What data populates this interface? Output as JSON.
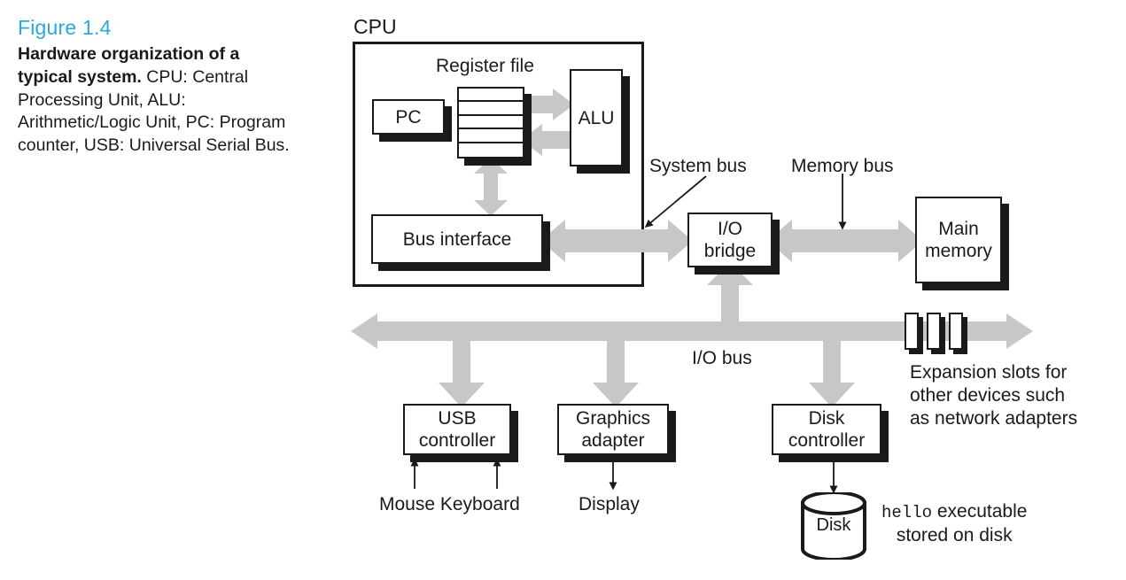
{
  "figure": {
    "number": "Figure 1.4",
    "title": "Hardware organization of a typical system.",
    "description": " CPU: Central Processing Unit, ALU: Arithmetic/Logic Unit, PC: Program counter, USB: Universal Serial Bus."
  },
  "colors": {
    "accent": "#29a8df",
    "ink": "#1a1a1a",
    "bus_gray": "#c6c7c9",
    "background": "#ffffff"
  },
  "diagram": {
    "cpu_label": "CPU",
    "register_file_label": "Register file",
    "register_rows": 5,
    "blocks": {
      "pc": "PC",
      "alu": "ALU",
      "bus_interface": "Bus interface",
      "io_bridge_line1": "I/O",
      "io_bridge_line2": "bridge",
      "main_memory_line1": "Main",
      "main_memory_line2": "memory",
      "usb_controller_line1": "USB",
      "usb_controller_line2": "controller",
      "graphics_adapter_line1": "Graphics",
      "graphics_adapter_line2": "adapter",
      "disk_controller_line1": "Disk",
      "disk_controller_line2": "controller",
      "disk": "Disk"
    },
    "bus_labels": {
      "system_bus": "System bus",
      "memory_bus": "Memory bus",
      "io_bus": "I/O bus"
    },
    "annotations": {
      "expansion_slots_line1": "Expansion slots for",
      "expansion_slots_line2": "other devices such",
      "expansion_slots_line3": "as network adapters",
      "peripherals_usb": "Mouse Keyboard",
      "peripheral_display": "Display",
      "disk_note_mono": "hello",
      "disk_note_rest": " executable",
      "disk_note_line2": "stored on disk"
    }
  }
}
